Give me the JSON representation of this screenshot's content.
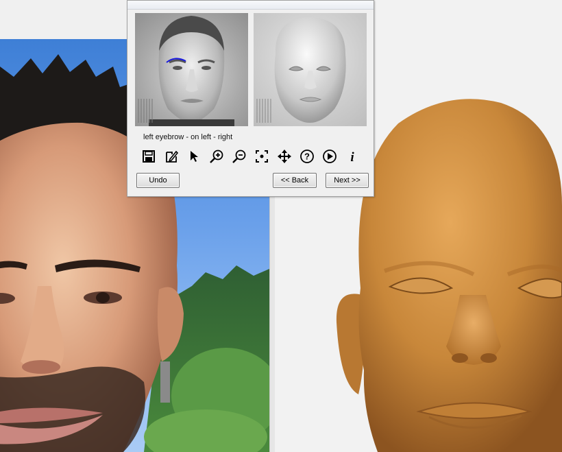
{
  "dialog": {
    "instruction": "left eyebrow - on left - right",
    "tools": [
      {
        "name": "save-icon"
      },
      {
        "name": "edit-document-icon"
      },
      {
        "name": "pointer-icon"
      },
      {
        "name": "zoom-in-icon"
      },
      {
        "name": "zoom-out-icon"
      },
      {
        "name": "fit-view-icon"
      },
      {
        "name": "move-icon"
      },
      {
        "name": "help-icon"
      },
      {
        "name": "play-icon"
      },
      {
        "name": "info-icon"
      }
    ],
    "buttons": {
      "undo": "Undo",
      "back": "<< Back",
      "next": "Next >>"
    }
  },
  "colors": {
    "sky": "#5a94e2",
    "skin_3d": "#c8873a",
    "marker": "#1a1adf",
    "dialog_bg": "#f0f0f0"
  }
}
